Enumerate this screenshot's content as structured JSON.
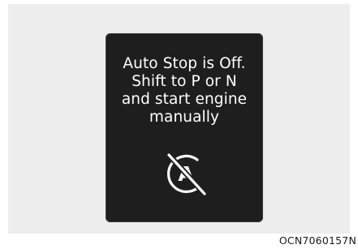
{
  "display": {
    "message_lines": [
      "Auto Stop is Off.",
      "Shift to P or N",
      "and start engine",
      "manually"
    ],
    "icon": "auto-stop-off-icon",
    "icon_letter": "A"
  },
  "caption": "OCN7060157N",
  "colors": {
    "background": "#ededed",
    "panel": "#1e1e1e",
    "text": "#ffffff"
  }
}
